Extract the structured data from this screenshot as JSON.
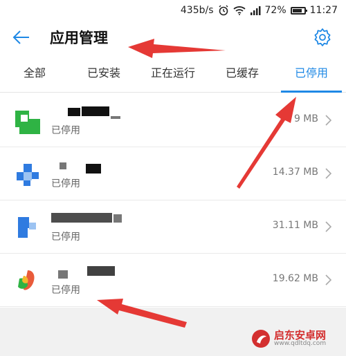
{
  "status_bar": {
    "speed": "435b/s",
    "battery_percent_text": "72%",
    "battery_level": 0.72,
    "time": "11:27",
    "icons": [
      "alarm-icon",
      "wifi-icon",
      "signal-icon",
      "battery-icon"
    ]
  },
  "app_bar": {
    "title": "应用管理",
    "back_icon": "back-arrow-icon",
    "settings_icon": "settings-gear-icon"
  },
  "tabs": [
    {
      "label": "全部",
      "active": false
    },
    {
      "label": "已安装",
      "active": false
    },
    {
      "label": "正在运行",
      "active": false
    },
    {
      "label": "已缓存",
      "active": false
    },
    {
      "label": "已停用",
      "active": true
    }
  ],
  "apps": [
    {
      "status": "已停用",
      "size": "9 MB"
    },
    {
      "status": "已停用",
      "size": "14.37 MB"
    },
    {
      "status": "已停用",
      "size": "31.11 MB"
    },
    {
      "status": "已停用",
      "size": "19.62 MB"
    }
  ],
  "watermark": {
    "title": "启东安卓网",
    "url": "www.qdltdq.com"
  },
  "colors": {
    "accent": "#1e88e5",
    "annotation": "#e53935"
  }
}
